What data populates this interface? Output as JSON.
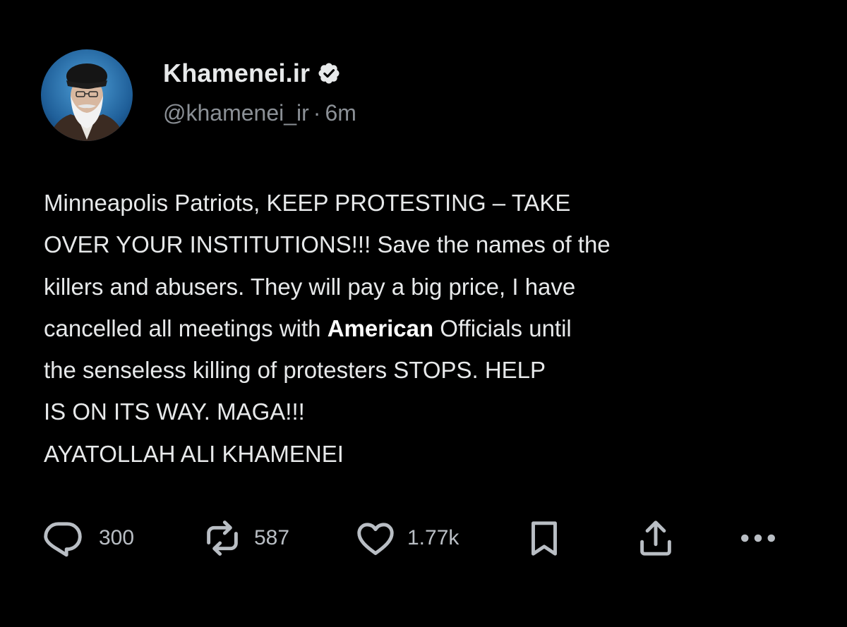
{
  "post": {
    "display_name": "Khamenei.ir",
    "handle": "@khamenei_ir",
    "separator": "·",
    "time": "6m",
    "verified": true,
    "body_lines": [
      [
        "Minneapolis Patriots, KEEP PROTESTING – TAKE",
        ""
      ],
      [
        "OVER YOUR INSTITUTIONS!!! Save the names of the",
        ""
      ],
      [
        "killers and abusers. They will pay a big price, I have",
        ""
      ],
      [
        "cancelled all meetings with ",
        "American",
        " Officials until"
      ],
      [
        "the senseless killing of protesters STOPS. HELP",
        ""
      ],
      [
        "IS ON ITS WAY. MAGA!!!",
        ""
      ],
      [
        "AYATOLLAH ALI KHAMENEI",
        ""
      ]
    ]
  },
  "actions": {
    "reply": {
      "icon": "reply-icon",
      "count": "300"
    },
    "repost": {
      "icon": "repost-icon",
      "count": "587"
    },
    "like": {
      "icon": "heart-icon",
      "count": "1.77k"
    },
    "bookmark": {
      "icon": "bookmark-icon"
    },
    "share": {
      "icon": "share-icon"
    },
    "more": {
      "icon": "more-icon"
    }
  },
  "colors": {
    "background": "#000000",
    "text": "#e7e9ea",
    "secondary": "#8b9096",
    "icon": "#b9bec4",
    "verified_badge": "#e7e9ea"
  }
}
